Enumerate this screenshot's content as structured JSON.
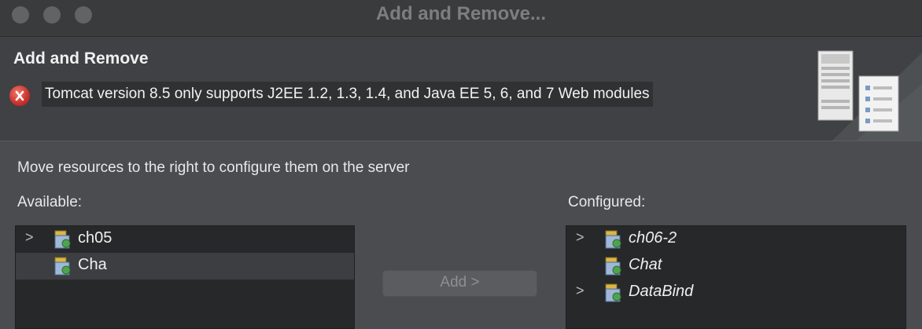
{
  "window": {
    "title": "Add and Remove..."
  },
  "header": {
    "title": "Add and Remove",
    "error_message": "Tomcat version 8.5 only supports J2EE 1.2, 1.3, 1.4, and Java EE 5, 6, and 7 Web modules"
  },
  "instruction": "Move resources to the right to configure them on the server",
  "available": {
    "label": "Available:",
    "items": [
      {
        "label": "ch05",
        "expandable": true,
        "selected": false
      },
      {
        "label": "Cha",
        "expandable": false,
        "selected": true
      }
    ]
  },
  "configured": {
    "label": "Configured:",
    "items": [
      {
        "label": "ch06-2",
        "expandable": true
      },
      {
        "label": "Chat",
        "expandable": false
      },
      {
        "label": "DataBind",
        "expandable": true
      }
    ]
  },
  "buttons": {
    "add_label": "Add >"
  },
  "icons": {
    "error": "error-x-icon",
    "module": "web-module-icon",
    "expand": "chevron-right-icon",
    "server": "server-banner-icon"
  },
  "colors": {
    "error": "#c9302c",
    "background": "#4a4c4f",
    "list_bg": "#27282a"
  }
}
